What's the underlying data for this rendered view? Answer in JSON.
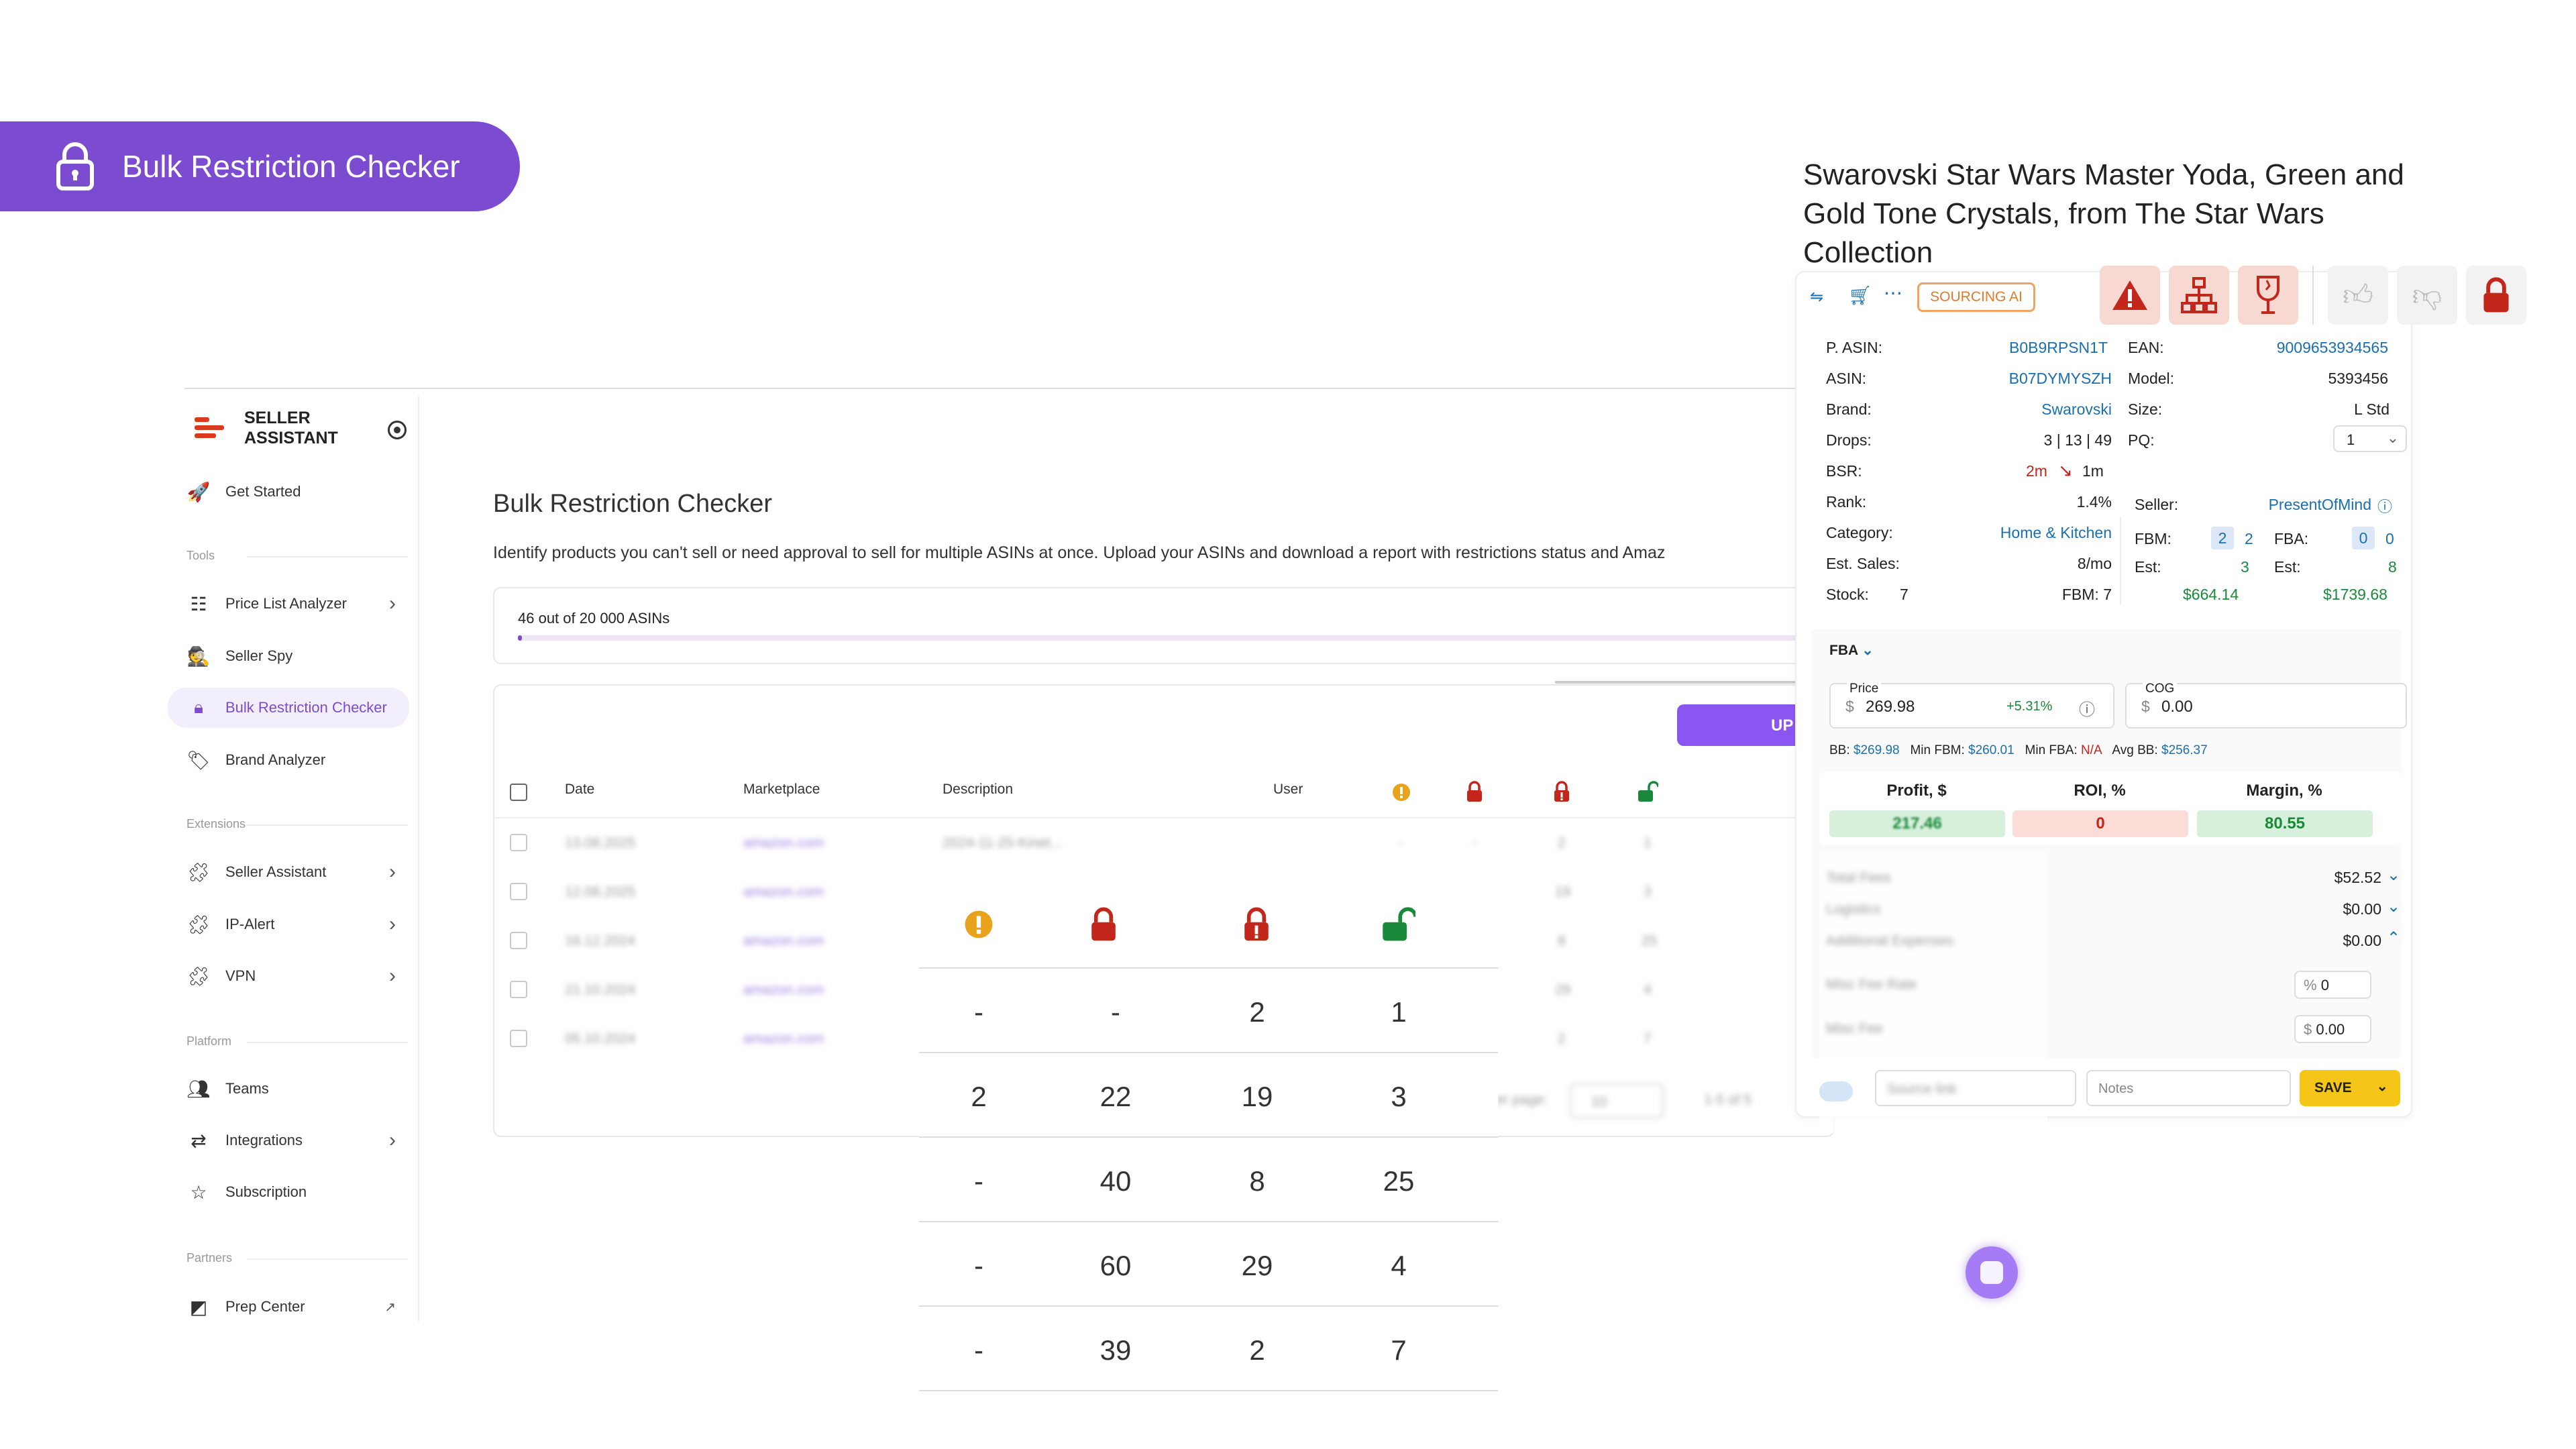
{
  "banner": {
    "title": "Bulk Restriction Checker"
  },
  "sidebar": {
    "brand": "SELLER ASSISTANT",
    "brand_line1": "SELLER",
    "brand_line2": "ASSISTANT",
    "get_started": "Get Started",
    "sections": {
      "tools": "Tools",
      "extensions": "Extensions",
      "platform": "Platform",
      "partners": "Partners"
    },
    "tools": [
      "Price List Analyzer",
      "Seller Spy",
      "Bulk Restriction Checker",
      "Brand Analyzer"
    ],
    "extensions": [
      "Seller Assistant",
      "IP-Alert",
      "VPN"
    ],
    "platform": [
      "Teams",
      "Integrations",
      "Subscription"
    ],
    "partners": [
      "Prep Center"
    ]
  },
  "main": {
    "title": "Bulk Restriction Checker",
    "description": "Identify products you can't sell or need approval to sell for multiple ASINs at once. Upload your ASINs and download a report with restrictions status and Amaz",
    "progress_text": "46 out of 20 000 ASINs",
    "progress_value": 0.0023,
    "upload_label": "UP",
    "columns": [
      "Date",
      "Marketplace",
      "Description",
      "User"
    ],
    "rows": [
      {
        "date": "13.08.2025",
        "marketplace": "amazon.com",
        "description": "2024-11-25-Kinet..."
      },
      {
        "date": "12.08.2025",
        "marketplace": "amazon.com",
        "description": ""
      },
      {
        "date": "16.12.2024",
        "marketplace": "amazon.com",
        "description": ""
      },
      {
        "date": "21.10.2024",
        "marketplace": "amazon.com",
        "description": ""
      },
      {
        "date": "05.10.2024",
        "marketplace": "amazon.com",
        "description": ""
      }
    ],
    "row_counts": [
      [
        "-",
        "-",
        "2",
        "1"
      ],
      [
        "2",
        "22",
        "19",
        "3"
      ],
      [
        "-",
        "40",
        "8",
        "25"
      ],
      [
        "-",
        "60",
        "29",
        "4"
      ],
      [
        "-",
        "39",
        "2",
        "7"
      ]
    ],
    "pager": {
      "per_page_label": "er page:",
      "per_page": "10",
      "range": "1-5 of 5"
    }
  },
  "zoom": {
    "rows": [
      [
        "-",
        "-",
        "2",
        "1"
      ],
      [
        "2",
        "22",
        "19",
        "3"
      ],
      [
        "-",
        "40",
        "8",
        "25"
      ],
      [
        "-",
        "60",
        "29",
        "4"
      ],
      [
        "-",
        "39",
        "2",
        "7"
      ]
    ]
  },
  "panel": {
    "title": "Swarovski Star Wars Master Yoda, Green and Gold Tone Crystals, from The Star Wars Collection",
    "sourcing_ai": "SOURCING AI",
    "left": {
      "p_asin_label": "P. ASIN:",
      "p_asin": "B0B9RPSN1T",
      "asin_label": "ASIN:",
      "asin": "B07DYMYSZH",
      "brand_label": "Brand:",
      "brand": "Swarovski",
      "drops_label": "Drops:",
      "drops": "3 | 13 | 49",
      "bsr_label": "BSR:",
      "bsr_a": "2m",
      "bsr_b": "1m",
      "rank_label": "Rank:",
      "rank": "1.4%",
      "category_label": "Category:",
      "category": "Home & Kitchen",
      "est_sales_label": "Est. Sales:",
      "est_sales": "8/mo",
      "stock_label": "Stock:",
      "stock": "7",
      "fbm_stock": "FBM: 7"
    },
    "right": {
      "ean_label": "EAN:",
      "ean": "9009653934565",
      "model_label": "Model:",
      "model": "5393456",
      "size_label": "Size:",
      "size": "L Std",
      "pq_label": "PQ:",
      "pq": "1",
      "seller_label": "Seller:",
      "seller": "PresentOfMind",
      "fbm_label": "FBM:",
      "fbm_a": "2",
      "fbm_b": "2",
      "fba_label": "FBA:",
      "fba_a": "0",
      "fba_b": "0",
      "est_label": "Est:",
      "est_fbm": "3",
      "est_fba": "8",
      "money_fbm": "$664.14",
      "money_fba": "$1739.68"
    },
    "fba": {
      "mode": "FBA",
      "price_label": "Price",
      "price": "269.98",
      "price_change": "+5.31%",
      "cog_label": "COG",
      "cog": "0.00",
      "bb_label": "BB:",
      "bb": "$269.98",
      "min_fbm_label": "Min FBM:",
      "min_fbm": "$260.01",
      "min_fba_label": "Min FBA:",
      "min_fba": "N/A",
      "avg_bb_label": "Avg BB:",
      "avg_bb": "$256.37",
      "profit_label": "Profit, $",
      "profit": "217.46",
      "roi_label": "ROI, %",
      "roi": "0",
      "margin_label": "Margin, %",
      "margin": "80.55",
      "total_fees_label": "Total Fees",
      "total_fees": "$52.52",
      "logistics_label": "Logistics",
      "logistics": "$0.00",
      "additional_label": "Additional Expenses",
      "additional": "$0.00",
      "misc_rate_label": "Misc Fee Rate",
      "misc_rate": "0",
      "misc_fee_label": "Misc Fee",
      "misc_fee": "0.00",
      "source_placeholder": "Source link",
      "notes_placeholder": "Notes",
      "save_label": "SAVE"
    }
  },
  "colors": {
    "accent": "#7b4bd0",
    "orange": "#e8a21b",
    "red": "#c3261a",
    "green": "#1a8a3a",
    "save": "#f5c518"
  }
}
